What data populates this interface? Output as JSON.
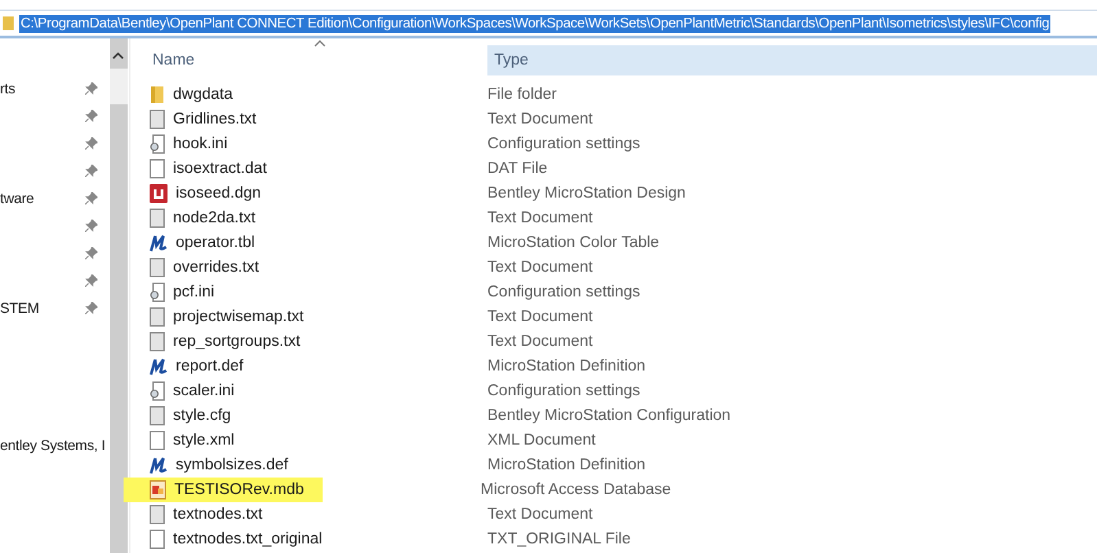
{
  "address_bar": {
    "path": "C:\\ProgramData\\Bentley\\OpenPlant CONNECT Edition\\Configuration\\WorkSpaces\\WorkSpace\\WorkSets\\OpenPlantMetric\\Standards\\OpenPlant\\Isometrics\\styles\\IFC\\config",
    "selected": true
  },
  "sidebar": {
    "items": [
      {
        "label": "rts",
        "pinned": true
      },
      {
        "pinned": true
      },
      {
        "pinned": true
      },
      {
        "pinned": true
      },
      {
        "label": "tware",
        "pinned": true
      },
      {
        "pinned": true
      },
      {
        "pinned": true
      },
      {
        "pinned": true
      },
      {
        "label": "STEM",
        "pinned": true
      },
      {
        "pinned": false
      },
      {
        "pinned": false
      },
      {
        "pinned": false
      },
      {
        "pinned": false
      },
      {
        "label": "entley Systems, I",
        "pinned": false
      }
    ]
  },
  "columns": [
    {
      "label": "Name",
      "hovered": false
    },
    {
      "label": "Type",
      "hovered": true
    }
  ],
  "files": [
    {
      "name": "dwgdata",
      "type": "File folder",
      "kind": "folder",
      "highlighted": false
    },
    {
      "name": "Gridlines.txt",
      "type": "Text Document",
      "kind": "text",
      "highlighted": false
    },
    {
      "name": "hook.ini",
      "type": "Configuration settings",
      "kind": "settings",
      "highlighted": false
    },
    {
      "name": "isoextract.dat",
      "type": "DAT File",
      "kind": "blank",
      "highlighted": false
    },
    {
      "name": "isoseed.dgn",
      "type": "Bentley MicroStation Design",
      "kind": "design",
      "highlighted": false
    },
    {
      "name": "node2da.txt",
      "type": "Text Document",
      "kind": "text",
      "highlighted": false
    },
    {
      "name": "operator.tbl",
      "type": "MicroStation Color Table",
      "kind": "micro",
      "highlighted": false
    },
    {
      "name": "overrides.txt",
      "type": "Text Document",
      "kind": "text",
      "highlighted": false
    },
    {
      "name": "pcf.ini",
      "type": "Configuration settings",
      "kind": "settings",
      "highlighted": false
    },
    {
      "name": "projectwisemap.txt",
      "type": "Text Document",
      "kind": "text",
      "highlighted": false
    },
    {
      "name": "rep_sortgroups.txt",
      "type": "Text Document",
      "kind": "text",
      "highlighted": false
    },
    {
      "name": "report.def",
      "type": "MicroStation Definition",
      "kind": "micro",
      "highlighted": false
    },
    {
      "name": "scaler.ini",
      "type": "Configuration settings",
      "kind": "settings",
      "highlighted": false
    },
    {
      "name": "style.cfg",
      "type": "Bentley MicroStation Configuration",
      "kind": "text",
      "highlighted": false
    },
    {
      "name": "style.xml",
      "type": "XML Document",
      "kind": "blank",
      "highlighted": false
    },
    {
      "name": "symbolsizes.def",
      "type": "MicroStation Definition",
      "kind": "micro",
      "highlighted": false
    },
    {
      "name": "TESTISORev.mdb",
      "type": "Microsoft Access Database",
      "kind": "database",
      "highlighted": true
    },
    {
      "name": "textnodes.txt",
      "type": "Text Document",
      "kind": "text",
      "highlighted": false
    },
    {
      "name": "textnodes.txt_original",
      "type": "TXT_ORIGINAL File",
      "kind": "blank",
      "highlighted": false
    }
  ]
}
